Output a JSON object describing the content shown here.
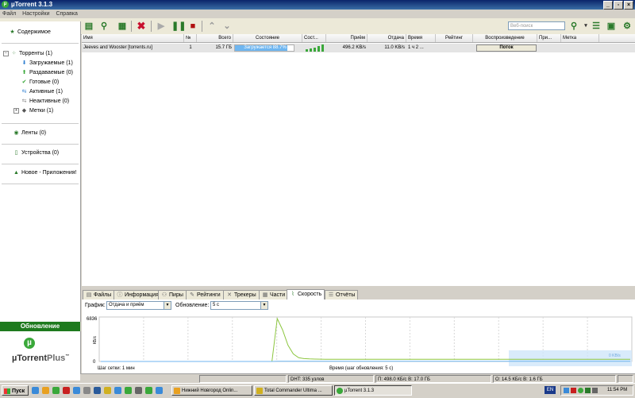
{
  "window": {
    "title": "µTorrent 3.1.3",
    "controls": [
      "_",
      "▫",
      "×"
    ]
  },
  "menu": [
    "Файл",
    "Настройки",
    "Справка"
  ],
  "toolbar": {
    "search_placeholder": "Веб-поиск",
    "icons": [
      "add-torrent-icon",
      "add-url-icon",
      "create-torrent-icon",
      "remove-icon",
      "start-icon",
      "pause-icon",
      "stop-icon",
      "queue-up-icon",
      "queue-down-icon"
    ]
  },
  "sidebar": {
    "featured": "Содержимое",
    "torrents": "Торренты (1)",
    "items": [
      "Загружаемые (1)",
      "Раздаваемые (0)",
      "Готовые (0)",
      "Активные (1)",
      "Неактивные (0)",
      "Метки (1)"
    ],
    "feeds": "Ленты (0)",
    "devices": "Устройства (0)",
    "apps": "Новое - Приложения!",
    "update": "Обновление",
    "plus_name": "µTorrent",
    "plus_suffix": "Plus",
    "plus_tm": "™"
  },
  "columns": [
    "Имя",
    "№",
    "Всего",
    "Состояние",
    "Сост...",
    "Приём",
    "Отдача",
    "Время",
    "Рейтинг",
    "Воспроизведение",
    "При...",
    "Метка"
  ],
  "torrent": {
    "name": "Jeeves and Wooster [torrents.ru]",
    "num": "1",
    "size": "15.7 ГБ",
    "status": "Загружается 88.7%",
    "progress": 88.7,
    "down": "496.2 KB/s",
    "up": "11.0 KB/s",
    "eta": "1 ч 2 ...",
    "rating": "",
    "stream": "Поток"
  },
  "tabs": [
    "Файлы",
    "Информация",
    "Пиры",
    "Рейтинги",
    "Трекеры",
    "Части",
    "Скорость",
    "Отчёты"
  ],
  "active_tab": "Скорость",
  "graph_panel": {
    "graph_label": "График:",
    "graph_value": "Отдача и приём",
    "update_label": "Обновление:",
    "update_value": "5 с",
    "grid_step": "Шаг сетки: 1 мин",
    "time_step": "Время (шаг обновления: 5 с)",
    "live_label": "0 KB/s"
  },
  "chart_data": {
    "type": "line",
    "ylabel": "КБ/с",
    "yticks": [
      "6836",
      "0"
    ],
    "ylim": [
      0,
      6836
    ],
    "series": [
      {
        "name": "download",
        "color": "#8cc63f",
        "values": [
          0,
          0,
          0,
          0,
          0,
          0,
          0,
          0,
          0,
          0,
          0,
          0,
          0,
          0,
          0,
          0,
          0,
          0,
          0,
          0,
          0,
          0,
          0,
          0,
          0,
          0,
          0,
          0,
          0,
          0,
          0,
          0,
          0,
          6836,
          5000,
          2600,
          1200,
          600,
          450,
          400,
          380,
          370,
          360,
          360,
          360,
          360,
          360,
          360,
          360,
          360,
          360,
          360,
          360,
          360,
          360,
          360,
          360,
          360,
          360,
          360,
          360,
          360,
          360,
          360,
          360,
          360,
          360,
          360,
          360,
          360,
          360,
          360,
          360,
          360,
          360,
          360,
          360,
          360,
          360,
          360,
          360,
          360,
          360,
          360,
          360,
          360,
          360,
          360,
          360,
          360,
          360,
          360,
          360,
          360,
          360,
          360,
          360,
          360,
          360,
          360
        ]
      },
      {
        "name": "upload",
        "color": "#6fb6f0",
        "values": [
          0,
          0,
          0,
          0,
          0,
          0,
          0,
          0,
          0,
          0,
          0,
          0,
          0,
          0,
          0,
          0,
          0,
          0,
          0,
          0,
          0,
          0,
          0,
          0,
          0,
          0,
          0,
          0,
          0,
          0,
          0,
          0,
          0,
          30,
          30,
          30,
          30,
          30,
          30,
          30,
          30,
          30,
          30,
          30,
          30,
          30,
          30,
          30,
          30,
          30,
          30,
          30,
          30,
          30,
          30,
          30,
          30,
          30,
          30,
          30,
          30,
          30,
          30,
          30,
          30,
          30,
          30,
          30,
          30,
          30,
          30,
          30,
          30,
          30,
          30,
          30,
          30,
          30,
          30,
          30,
          30,
          30,
          30,
          30,
          30,
          30,
          30,
          30,
          30,
          30,
          30,
          30,
          30,
          30,
          30,
          30,
          30,
          30,
          30,
          30
        ]
      }
    ]
  },
  "statusbar": {
    "dht": "DHT: 335 узлов",
    "down": "П: 498.0 КБ/с В: 17.0 ГБ",
    "up": "О: 14.5 КБ/с В: 1.6 ГБ"
  },
  "taskbar": {
    "start": "Пуск",
    "tasks": [
      "Нижний Новгород Onlin...",
      "Total Commander Ultima ...",
      "µTorrent 3.1.3"
    ],
    "lang": "EN",
    "clock": "11:54 PM"
  }
}
